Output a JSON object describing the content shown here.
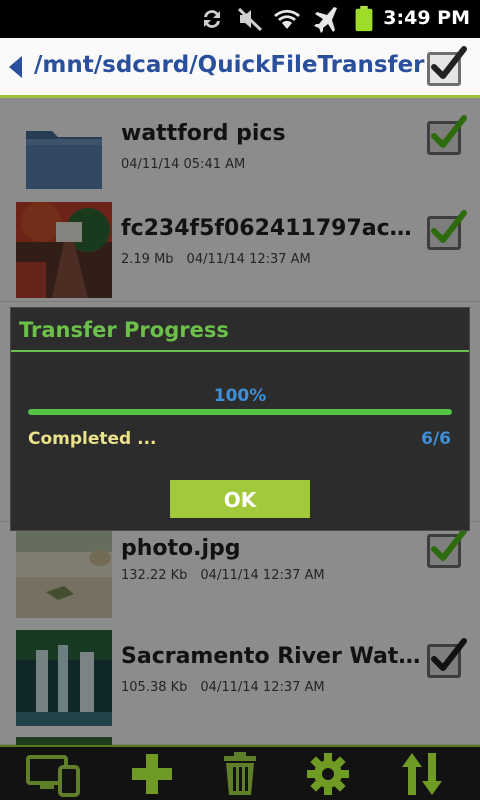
{
  "status_bar": {
    "time": "3:49 PM",
    "icons": [
      "sync-icon",
      "mute-icon",
      "wifi-icon",
      "airplane-icon",
      "battery-icon"
    ]
  },
  "header": {
    "path": "/mnt/sdcard/QuickFileTransfer",
    "select_all_checked": true
  },
  "files": [
    {
      "name": "wattford pics",
      "size": "",
      "date": "04/11/14 05:41 AM",
      "type": "folder",
      "checked": true
    },
    {
      "name": "fc234f5f062411797acc5f9...",
      "size": "2.19 Mb",
      "date": "04/11/14 12:37 AM",
      "type": "image",
      "checked": true
    },
    {
      "name": "photo.jpg",
      "size": "132.22 Kb",
      "date": "04/11/14 12:37 AM",
      "type": "image",
      "checked": true
    },
    {
      "name": "Sacramento River Waterf...",
      "size": "105.38 Kb",
      "date": "04/11/14 12:37 AM",
      "type": "image",
      "checked": true
    }
  ],
  "dialog": {
    "title": "Transfer Progress",
    "percent_text": "100%",
    "progress": 1.0,
    "status": "Completed ...",
    "count": "6/6",
    "ok_label": "OK"
  },
  "toolbar": {
    "icons": [
      "devices-icon",
      "add-icon",
      "trash-icon",
      "settings-icon",
      "transfer-icon"
    ]
  },
  "colors": {
    "accent_green": "#6cc04a",
    "path_blue": "#2a4f9c",
    "progress_blue": "#3e8fd8",
    "button_green": "#a2c83c",
    "status_yellow": "#e9e28a"
  }
}
